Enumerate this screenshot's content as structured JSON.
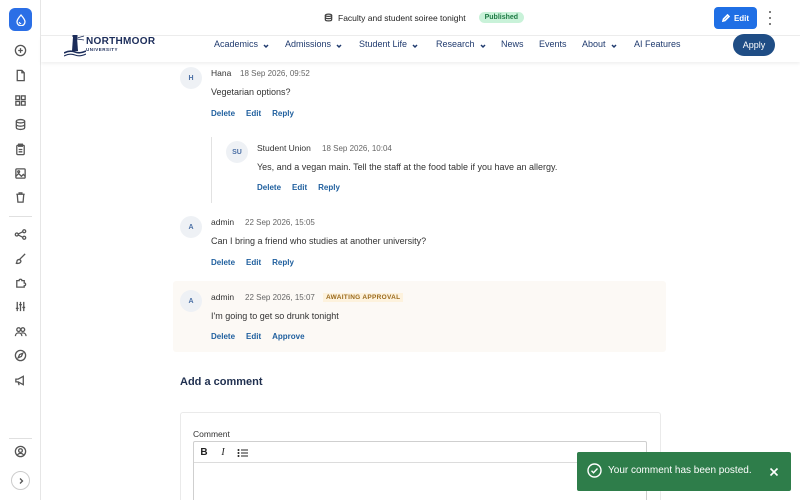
{
  "rail": {
    "logo_icon": "drop-logo-icon",
    "icons": [
      "plus-circle-icon",
      "file-icon",
      "grid-icon",
      "database-icon",
      "clipboard-icon",
      "image-gallery-icon",
      "trash-icon",
      "workflow-icon",
      "brush-icon",
      "puzzle-icon",
      "sliders-icon",
      "users-icon",
      "compass-icon",
      "megaphone-icon",
      "user-circle-icon",
      "chevron-right-icon"
    ]
  },
  "topbar": {
    "doc_title": "Faculty and student soiree tonight",
    "status": "Published",
    "edit_label": "Edit"
  },
  "site": {
    "brand_name": "NORTHMOOR",
    "brand_sub": "UNIVERSITY",
    "nav": [
      {
        "label": "Academics"
      },
      {
        "label": "Admissions"
      },
      {
        "label": "Student Life"
      },
      {
        "label": "Research"
      },
      {
        "label": "News"
      },
      {
        "label": "Events"
      },
      {
        "label": "About"
      },
      {
        "label": "AI Features"
      }
    ],
    "apply_label": "Apply"
  },
  "comments": [
    {
      "initials": "H",
      "name": "Hana",
      "date": "18 Sep 2026, 09:52",
      "text": "Vegetarian options?",
      "actions": [
        "Delete",
        "Edit",
        "Reply"
      ]
    },
    {
      "initials": "SU",
      "name": "Student Union",
      "date": "18 Sep 2026, 10:04",
      "text": "Yes, and a vegan main. Tell the staff at the food table if you have an allergy.",
      "actions": [
        "Delete",
        "Edit",
        "Reply"
      ]
    },
    {
      "initials": "A",
      "name": "admin",
      "date": "22 Sep 2026, 15:05",
      "text": "Can I bring a friend who studies at another university?",
      "actions": [
        "Delete",
        "Edit",
        "Reply"
      ]
    },
    {
      "initials": "A",
      "name": "admin",
      "date": "22 Sep 2026, 15:07",
      "badge": "AWAITING APPROVAL",
      "text": "I'm going to get so drunk tonight",
      "actions": [
        "Delete",
        "Edit",
        "Approve"
      ]
    }
  ],
  "form": {
    "heading": "Add a comment",
    "label": "Comment",
    "toolbar": {
      "bold": "B",
      "italic": "I"
    }
  },
  "toast": {
    "message": "Your comment has been posted."
  }
}
